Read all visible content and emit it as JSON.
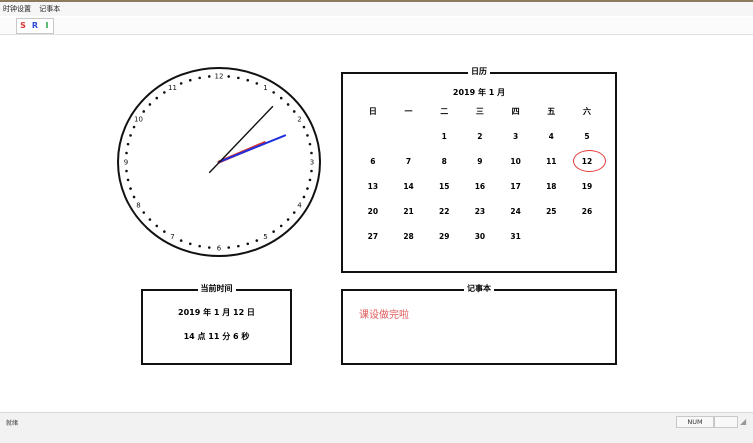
{
  "menu": {
    "items": [
      "时钟设置",
      "记事本"
    ]
  },
  "toolbar": {
    "buttons": [
      {
        "label": "S",
        "color": "#d6322f"
      },
      {
        "label": "R",
        "color": "#2e4bd6"
      },
      {
        "label": "I",
        "color": "#2fa84a"
      }
    ]
  },
  "clock": {
    "numbers": [
      "12",
      "1",
      "2",
      "3",
      "4",
      "5",
      "6",
      "7",
      "8",
      "9",
      "10",
      "11"
    ],
    "time": {
      "hour": 14,
      "minute": 11,
      "second": 6
    },
    "colors": {
      "hour_hand": "#d6322f",
      "minute_hand": "#1f2fe0",
      "second_hand": "#111111"
    }
  },
  "calendar": {
    "title": "日历",
    "month_label": "2019 年 1 月",
    "weekdays": [
      "日",
      "一",
      "二",
      "三",
      "四",
      "五",
      "六"
    ],
    "weeks": [
      [
        "",
        "",
        "1",
        "2",
        "3",
        "4",
        "5"
      ],
      [
        "6",
        "7",
        "8",
        "9",
        "10",
        "11",
        "12"
      ],
      [
        "13",
        "14",
        "15",
        "16",
        "17",
        "18",
        "19"
      ],
      [
        "20",
        "21",
        "22",
        "23",
        "24",
        "25",
        "26"
      ],
      [
        "27",
        "28",
        "29",
        "30",
        "31",
        "",
        ""
      ]
    ],
    "today": "12",
    "today_color": "#e23a3a"
  },
  "current_time": {
    "title": "当前时间",
    "date": "2019 年 1 月 12 日",
    "time": "14 点 11 分 6 秒"
  },
  "memo": {
    "title": "记事本",
    "text": "课设做完啦",
    "text_color": "#e05a5a"
  },
  "status": {
    "text": "就绪",
    "num": "NUM"
  }
}
